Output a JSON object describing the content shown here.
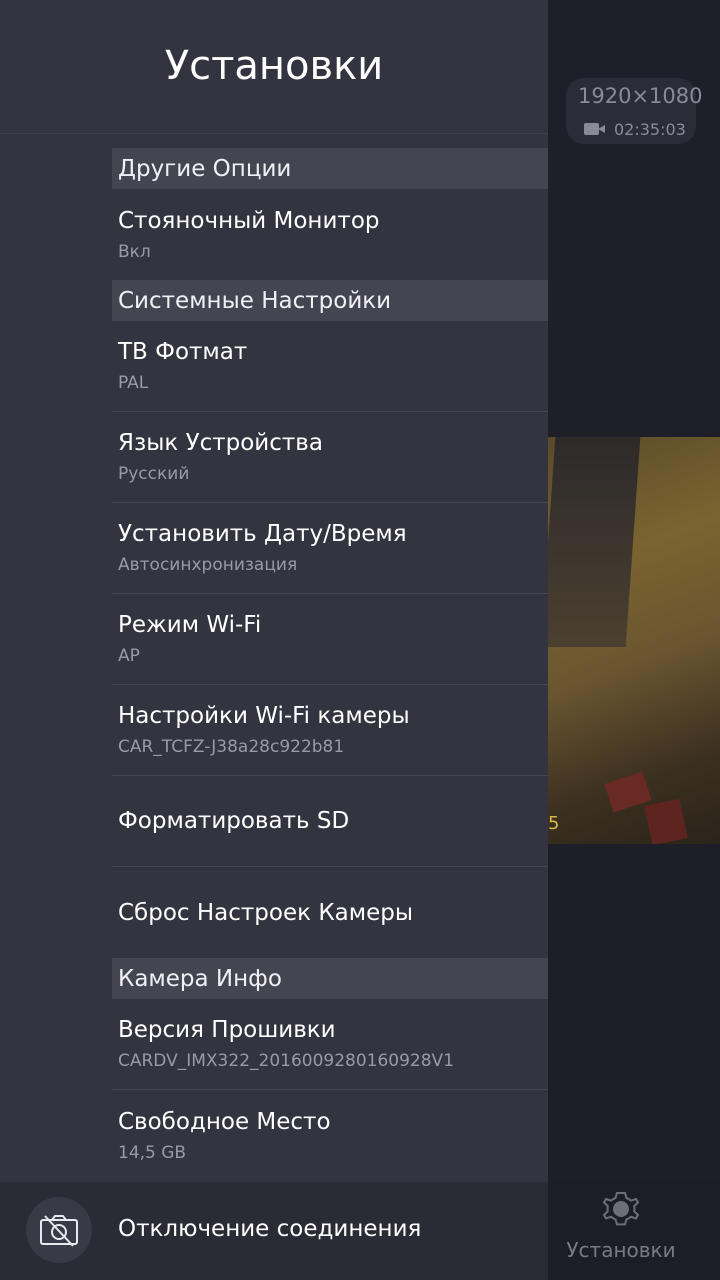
{
  "background": {
    "resolution": "1920×1080",
    "record_time": "02:35:03",
    "preview_stamp": "5",
    "tab_settings_label": "Установки"
  },
  "drawer": {
    "title": "Установки",
    "sections": {
      "other": {
        "header": "Другие Опции",
        "parking_monitor": {
          "title": "Стояночный Монитор",
          "value": "Вкл"
        }
      },
      "system": {
        "header": "Системные Настройки",
        "tv_format": {
          "title": "ТВ Фотмат",
          "value": "PAL"
        },
        "language": {
          "title": "Язык Устройства",
          "value": "Русский"
        },
        "datetime": {
          "title": "Установить Дату/Время",
          "value": "Автосинхронизация"
        },
        "wifi_mode": {
          "title": "Режим Wi-Fi",
          "value": "AP"
        },
        "wifi_settings": {
          "title": "Настройки Wi-Fi камеры",
          "value": "CAR_TCFZ-J38a28c922b81"
        },
        "format_sd": {
          "title": "Форматировать SD"
        },
        "reset": {
          "title": "Сброс Настроек Камеры"
        }
      },
      "camera_info": {
        "header": "Камера Инфо",
        "firmware": {
          "title": "Версия Прошивки",
          "value": "CARDV_IMX322_2016009280160928V1"
        },
        "free_space": {
          "title": "Свободное Место",
          "value": "14,5 GB"
        }
      }
    },
    "footer": {
      "disconnect_label": "Отключение соединения"
    }
  }
}
